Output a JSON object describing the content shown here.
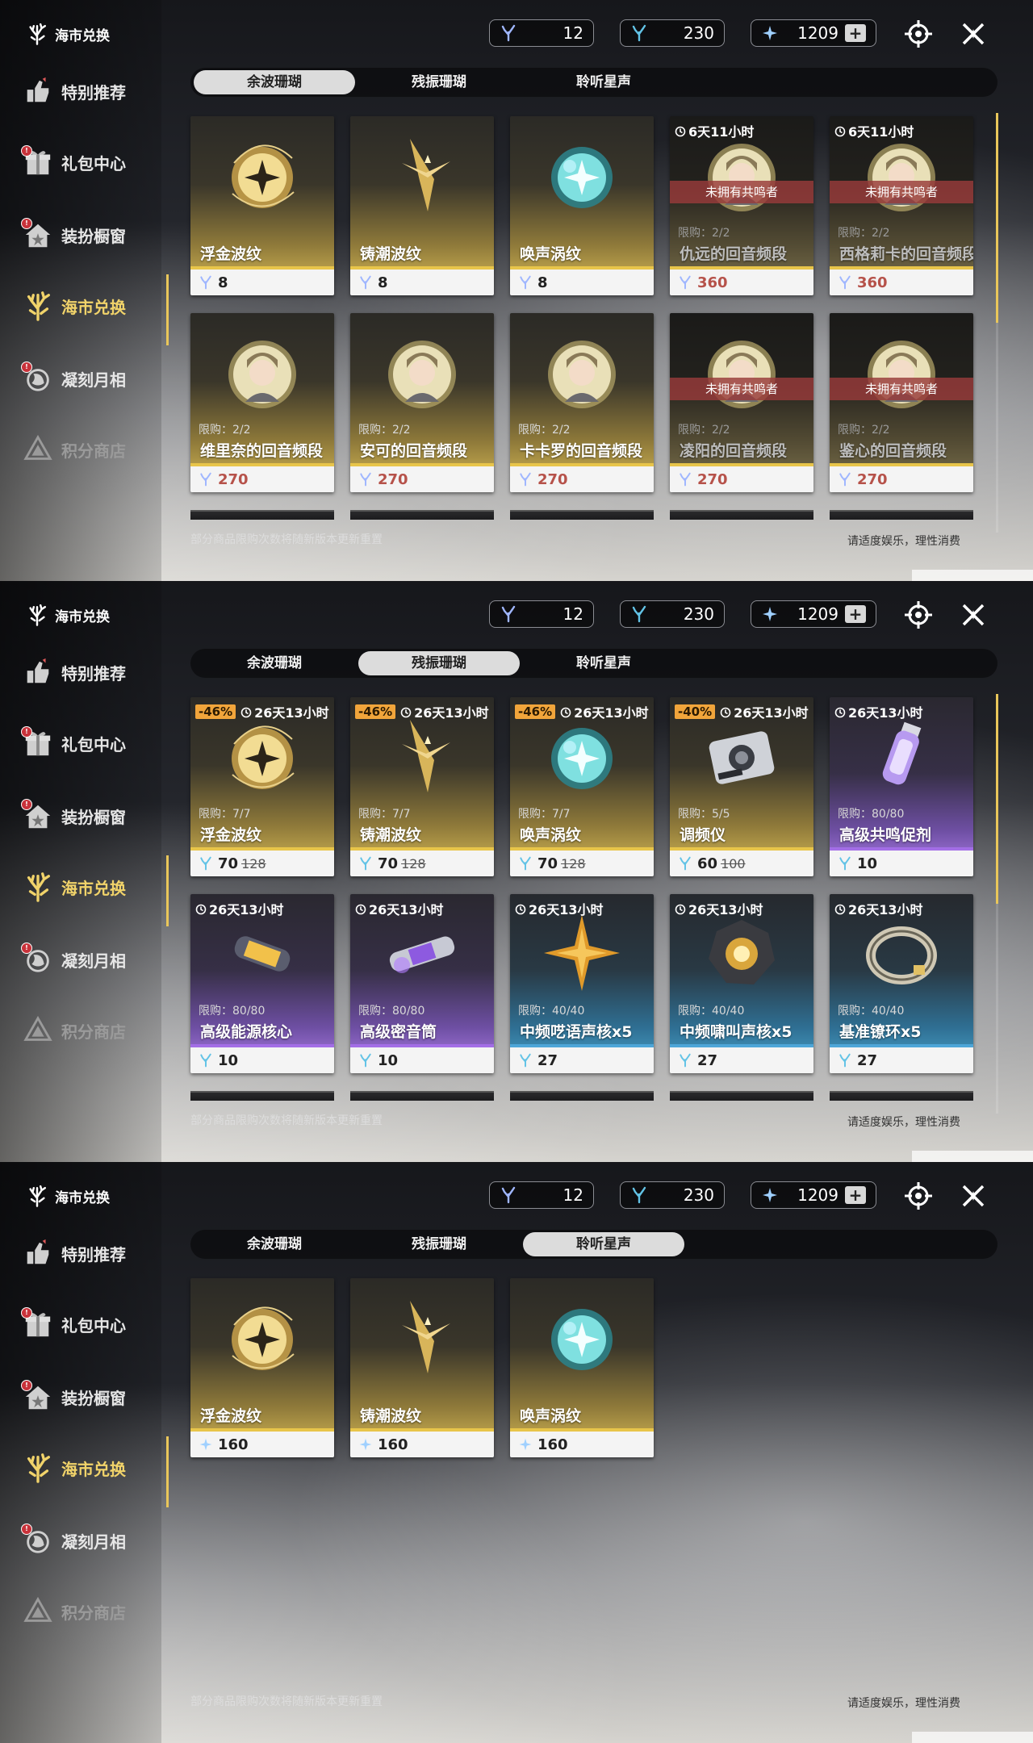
{
  "brand": {
    "title": "海市兑换"
  },
  "sidebar": {
    "items": [
      {
        "label": "特别推荐",
        "icon": "recommend-icon"
      },
      {
        "label": "礼包中心",
        "icon": "gift-icon"
      },
      {
        "label": "装扮橱窗",
        "icon": "outfit-icon"
      },
      {
        "label": "海市兑换",
        "icon": "coral-icon"
      },
      {
        "label": "凝刻月相",
        "icon": "moon-icon"
      },
      {
        "label": "积分商店",
        "icon": "points-icon"
      }
    ]
  },
  "currency": {
    "coral_afterglow": "12",
    "coral_oscillated": "230",
    "lunite": "1209",
    "plus": "+"
  },
  "tabs": [
    "余波珊瑚",
    "残振珊瑚",
    "聆听星声"
  ],
  "footer": {
    "left": "部分商品限购次数将随新版本更新重置",
    "right": "请适度娱乐，理性消费"
  },
  "panels": [
    {
      "selected_tab": 0,
      "cards": [
        {
          "name": "浮金波纹",
          "price": "8",
          "theme": "gold",
          "art": "gold-orb"
        },
        {
          "name": "铸潮波纹",
          "price": "8",
          "theme": "gold",
          "art": "gold-dagger"
        },
        {
          "name": "唤声涡纹",
          "price": "8",
          "theme": "gold",
          "art": "teal-orb"
        },
        {
          "name": "仇远的回音频段",
          "price": "360",
          "theme": "gold",
          "locked": true,
          "lock_text": "未拥有共鸣者",
          "limit": "限购：2/2",
          "timer": "6天11小时",
          "art": "portrait"
        },
        {
          "name": "西格莉卡的回音频段",
          "price": "360",
          "theme": "gold",
          "locked": true,
          "lock_text": "未拥有共鸣者",
          "limit": "限购：2/2",
          "timer": "6天11小时",
          "art": "portrait"
        },
        {
          "name": "维里奈的回音频段",
          "price": "270",
          "theme": "gold",
          "limit": "限购：2/2",
          "art": "portrait"
        },
        {
          "name": "安可的回音频段",
          "price": "270",
          "theme": "gold",
          "limit": "限购：2/2",
          "art": "portrait"
        },
        {
          "name": "卡卡罗的回音频段",
          "price": "270",
          "theme": "gold",
          "limit": "限购：2/2",
          "art": "portrait"
        },
        {
          "name": "凌阳的回音频段",
          "price": "270",
          "theme": "gold",
          "locked": true,
          "lock_text": "未拥有共鸣者",
          "limit": "限购：2/2",
          "art": "portrait"
        },
        {
          "name": "鉴心的回音频段",
          "price": "270",
          "theme": "gold",
          "locked": true,
          "lock_text": "未拥有共鸣者",
          "limit": "限购：2/2",
          "art": "portrait"
        }
      ]
    },
    {
      "selected_tab": 1,
      "cards": [
        {
          "name": "浮金波纹",
          "price": "70",
          "old": "128",
          "discount": "-46%",
          "timer": "26天13小时",
          "limit": "限购：7/7",
          "theme": "gold",
          "art": "gold-orb"
        },
        {
          "name": "铸潮波纹",
          "price": "70",
          "old": "128",
          "discount": "-46%",
          "timer": "26天13小时",
          "limit": "限购：7/7",
          "theme": "gold",
          "art": "gold-dagger"
        },
        {
          "name": "唤声涡纹",
          "price": "70",
          "old": "128",
          "discount": "-46%",
          "timer": "26天13小时",
          "limit": "限购：7/7",
          "theme": "gold",
          "art": "teal-orb"
        },
        {
          "name": "调频仪",
          "price": "60",
          "old": "100",
          "discount": "-40%",
          "timer": "26天13小时",
          "limit": "限购：5/5",
          "theme": "gold",
          "art": "device"
        },
        {
          "name": "高级共鸣促剂",
          "price": "10",
          "timer": "26天13小时",
          "limit": "限购：80/80",
          "theme": "purple",
          "art": "vial"
        },
        {
          "name": "高级能源核心",
          "price": "10",
          "timer": "26天13小时",
          "limit": "限购：80/80",
          "theme": "purple",
          "art": "capsule"
        },
        {
          "name": "高级密音筒",
          "price": "10",
          "timer": "26天13小时",
          "limit": "限购：80/80",
          "theme": "purple",
          "art": "tube"
        },
        {
          "name": "中频呓语声核x5",
          "price": "27",
          "timer": "26天13小时",
          "limit": "限购：40/40",
          "theme": "blue",
          "art": "star"
        },
        {
          "name": "中频啸叫声核x5",
          "price": "27",
          "timer": "26天13小时",
          "limit": "限购：40/40",
          "theme": "blue",
          "art": "core"
        },
        {
          "name": "基准镣环x5",
          "price": "27",
          "timer": "26天13小时",
          "limit": "限购：40/40",
          "theme": "blue",
          "art": "ring"
        }
      ]
    },
    {
      "selected_tab": 2,
      "cards": [
        {
          "name": "浮金波纹",
          "price": "160",
          "theme": "gold",
          "art": "gold-orb"
        },
        {
          "name": "铸潮波纹",
          "price": "160",
          "theme": "gold",
          "art": "gold-dagger"
        },
        {
          "name": "唤声涡纹",
          "price": "160",
          "theme": "gold",
          "art": "teal-orb"
        }
      ]
    }
  ]
}
